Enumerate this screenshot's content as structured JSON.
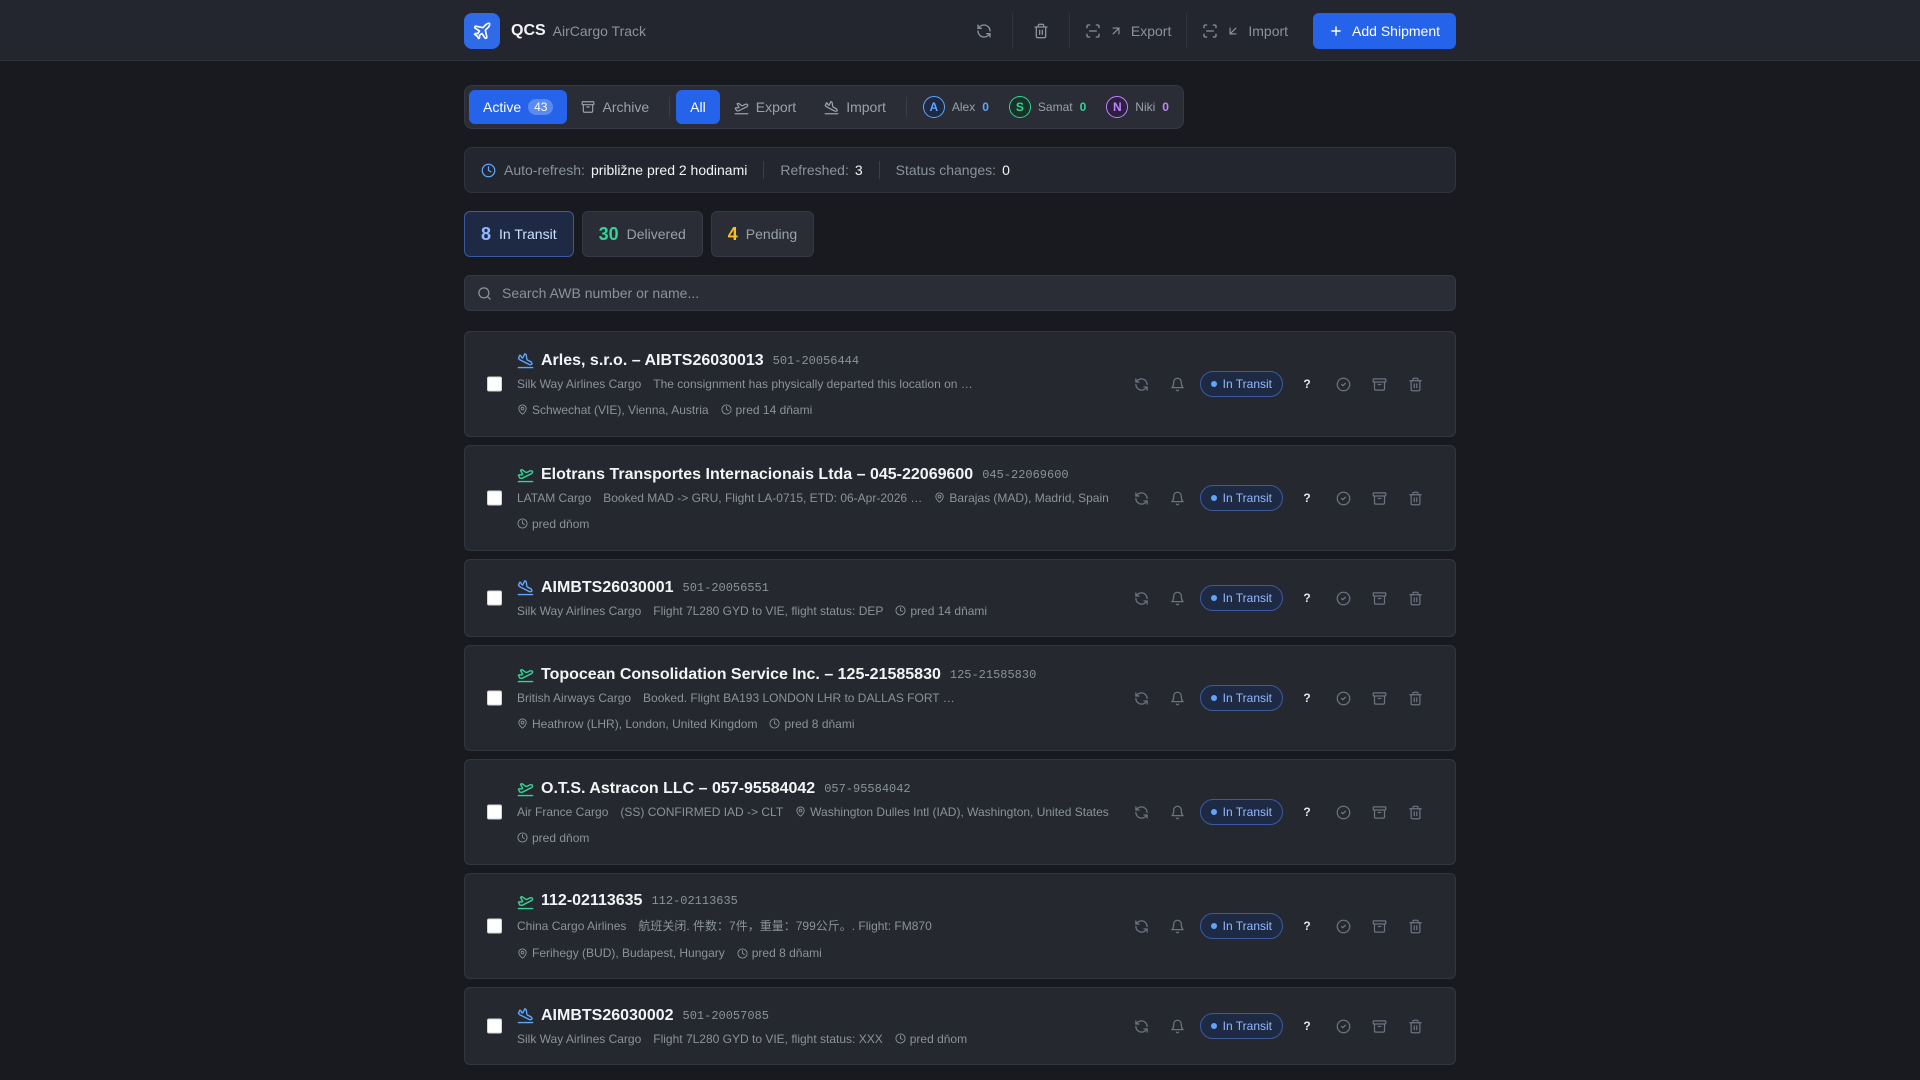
{
  "header": {
    "brand": "QCS",
    "subtitle": "AirCargo Track",
    "export_label": "Export",
    "import_label": "Import",
    "add_label": "Add Shipment"
  },
  "filters": {
    "active_label": "Active",
    "active_count": "43",
    "archive_label": "Archive",
    "all_label": "All",
    "export_label": "Export",
    "import_label": "Import",
    "users": [
      {
        "initial": "A",
        "name": "Alex",
        "count": "0",
        "color": "#60a5fa"
      },
      {
        "initial": "S",
        "name": "Samat",
        "count": "0",
        "color": "#34d399"
      },
      {
        "initial": "N",
        "name": "Niki",
        "count": "0",
        "color": "#c084fc"
      }
    ]
  },
  "refresh": {
    "auto_label": "Auto-refresh:",
    "auto_value": "približne pred 2 hodinami",
    "refreshed_label": "Refreshed:",
    "refreshed_value": "3",
    "changes_label": "Status changes:",
    "changes_value": "0"
  },
  "status_summary": {
    "transit_count": "8",
    "transit_label": "In Transit",
    "delivered_count": "30",
    "delivered_label": "Delivered",
    "pending_count": "4",
    "pending_label": "Pending"
  },
  "search": {
    "placeholder": "Search AWB number or name..."
  },
  "colors": {
    "accent": "#2563eb",
    "transit": "#93b8ff",
    "delivered": "#34d399",
    "pending": "#fbbf24"
  },
  "shipments": [
    {
      "icon": "plane-departure-icon",
      "title": "Arles, s.r.o. – AIBTS26030013",
      "awb": "501-20056444",
      "airline": "Silk Way Airlines Cargo",
      "desc": "The consignment has physically departed this location on …",
      "location": "Schwechat (VIE), Vienna, Austria",
      "time": "pred 14 dňami",
      "status": "In Transit"
    },
    {
      "icon": "plane-landing-icon",
      "title": "Elotrans Transportes Internacionais Ltda – 045-22069600",
      "awb": "045-22069600",
      "airline": "LATAM Cargo",
      "desc": "Booked MAD -> GRU, Flight LA-0715, ETD: 06-Apr-2026 …",
      "location": "Barajas (MAD), Madrid, Spain",
      "time": "pred dňom",
      "status": "In Transit"
    },
    {
      "icon": "plane-departure-icon",
      "title": "AIMBTS26030001",
      "awb": "501-20056551",
      "airline": "Silk Way Airlines Cargo",
      "desc": "Flight 7L280 GYD to VIE, flight status: DEP",
      "location": "",
      "time": "pred 14 dňami",
      "status": "In Transit"
    },
    {
      "icon": "plane-landing-icon",
      "title": "Topocean Consolidation Service Inc. – 125-21585830",
      "awb": "125-21585830",
      "airline": "British Airways Cargo",
      "desc": "Booked. Flight BA193 LONDON LHR to DALLAS FORT …",
      "location": "Heathrow (LHR), London, United Kingdom",
      "time": "pred 8 dňami",
      "status": "In Transit"
    },
    {
      "icon": "plane-landing-icon",
      "title": "O.T.S. Astracon LLC – 057-95584042",
      "awb": "057-95584042",
      "airline": "Air France Cargo",
      "desc": "(SS) CONFIRMED IAD -> CLT",
      "location": "Washington Dulles Intl (IAD), Washington, United States",
      "time": "pred dňom",
      "status": "In Transit"
    },
    {
      "icon": "plane-landing-icon",
      "title": "112-02113635",
      "awb": "112-02113635",
      "airline": "China Cargo Airlines",
      "desc": "航班关闭. 件数：7件，重量：799公斤。. Flight: FM870",
      "location": "Ferihegy (BUD), Budapest, Hungary",
      "time": "pred 8 dňami",
      "status": "In Transit"
    },
    {
      "icon": "plane-departure-icon",
      "title": "AIMBTS26030002",
      "awb": "501-20057085",
      "airline": "Silk Way Airlines Cargo",
      "desc": "Flight 7L280 GYD to VIE, flight status: XXX",
      "location": "",
      "time": "pred dňom",
      "status": "In Transit"
    }
  ]
}
